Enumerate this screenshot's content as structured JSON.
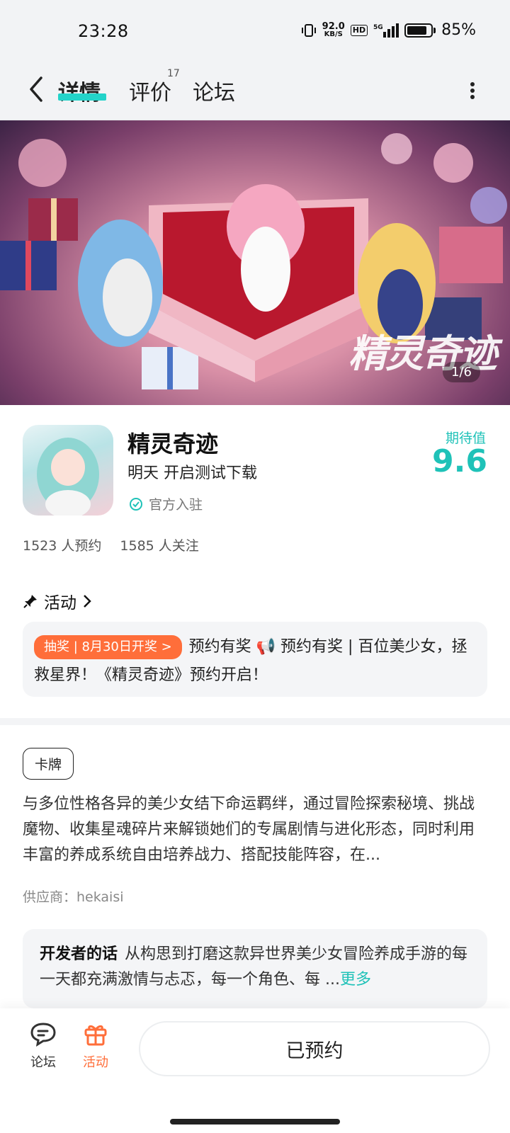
{
  "status_bar": {
    "time": "23:28",
    "speed_top": "92.0",
    "speed_unit": "KB/S",
    "hd": "HD",
    "network": "5G",
    "battery": "85%",
    "battery_level": 0.85
  },
  "header": {
    "tabs": [
      {
        "label": "详情",
        "active": true
      },
      {
        "label": "评价",
        "count": "17"
      },
      {
        "label": "论坛"
      }
    ]
  },
  "banner": {
    "brand_text": "精灵奇迹",
    "counter": "1/6"
  },
  "game": {
    "title": "精灵奇迹",
    "subtitle": "明天 开启测试下载",
    "official": "官方入驻",
    "expect_label": "期待值",
    "expect_value": "9.6",
    "reservations": "1523 人预约",
    "followers": "1585 人关注"
  },
  "activity": {
    "title": "活动",
    "pill": "抽奖 | 8月30日开奖 >",
    "text": "预约有奖 📢 预约有奖 | 百位美少女，拯救星界！《精灵奇迹》预约开启！"
  },
  "details": {
    "tag": "卡牌",
    "description": "与多位性格各异的美少女结下命运羁绊，通过冒险探索秘境、挑战魔物、收集星魂碎片来解锁她们的专属剧情与进化形态，同时利用丰富的养成系统自由培养战力、搭配技能阵容，在...",
    "supplier": "供应商：hekaisi"
  },
  "developer": {
    "label": "开发者的话",
    "text": "从构思到打磨这款异世界美少女冒险养成手游的每一天都充满激情与忐忑，每一个角色、每 ...",
    "more": "更多"
  },
  "bottom_bar": {
    "forum_label": "论坛",
    "activity_label": "活动",
    "reserve_label": "已预约"
  },
  "colors": {
    "accent": "#1fc2b8",
    "orange": "#ff6e3a"
  }
}
